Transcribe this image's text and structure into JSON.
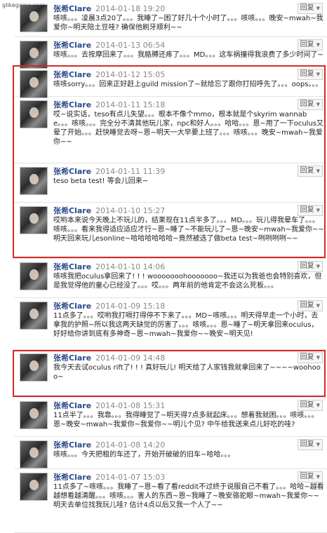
{
  "watermark": "glikegame.com",
  "reply_label": "回复",
  "posts": [
    {
      "author": "张希Clare",
      "time": "2014-01-18 19:20",
      "text": "咳咳。。。凌晨3点20了。。。我睡了~困了好几十个小时了。。。咳咳。。。晚安~mwah~我爱你~明天陪土豆哇? 确保他刷牙顺利~~"
    },
    {
      "author": "张希Clare",
      "time": "2014-01-13 06:54",
      "text": "咳咳。。。去按摩回来了。。。我胳膊还疼了。。。MD。。。这车祸撞得我浪费了多少时间了~"
    },
    {
      "author": "张希Clare",
      "time": "2014-01-12 15:05",
      "text": "咳咳sorry。。。回来正好赶上guild mission了~就给忘了跟你打招呼先了。。。oops。。。"
    },
    {
      "author": "张希Clare",
      "time": "2014-01-11 15:18",
      "text": "哎~说实话，teso有点儿失望。。。根本不像个mmo，根本就是个skyrim wannabe。。。咳咳。。。完全分不清其他玩儿家，npc和好人。。。哈哈。。。恩~用了一下oculus又晕了开始。。。赶快睡觉去呀~恩~明天一大早要上班了。。。咳咳。。。晚安~mwah~我爱你~~"
    },
    {
      "author": "张希Clare",
      "time": "2014-01-11 11:39",
      "text": "teso beta test! 等会儿回来~"
    },
    {
      "author": "张希Clare",
      "time": "2014-01-10 15:27",
      "text": "哎哟本来说今天晚上不玩儿的，结果现在11点半多了。。。MD。。。玩儿得我晕车了。。。咳咳。。。看来我得适应适应才行~恩~睡了~不能玩儿了~恩~晚安~mwah~我爱你~~明天回来玩儿esonline~哈哈哈哈哈哈~竟然被选了做beta test~咧咧咧咧~~"
    },
    {
      "author": "张希Clare",
      "time": "2014-01-10 14:06",
      "text": "咳咳我把oculus拿回来了! ! ! wooooooohooooooo~我还以为我爸也会特别喜欢，但是我觉得他的童心已经没了。。。哎。。。两年前的他肯定不会这么死板。。。"
    },
    {
      "author": "张希Clare",
      "time": "2014-01-09 15:18",
      "text": "11点多了。。。哎哟我打嗝打得停不下来了。。。MD~咳咳。。。明天得早走一个小时，去拿我的护照~所以我这两天缺觉的厉害了。。。咳咳。。。恩~睡了~明天拿回来oculus，好好给你讲到底有多神奇~恩~mwah~我爱你~~晚安~明天见!"
    },
    {
      "author": "张希Clare",
      "time": "2014-01-09 14:48",
      "text": "我今天去试oculus rift了! ! ! 真好玩儿! 明天给了人家钱我就拿回来了~~~~woohooo~"
    },
    {
      "author": "张希Clare",
      "time": "2014-01-08 15:31",
      "text": "11点半了。。。我靠。。。我得睡觉了~明天得7点多就起床。。。想着我就困。。。咳咳。。。恩~晚安~mwah~我爱你~我爱你~~明儿个见? 中午给我送来点儿好吃的哇?"
    },
    {
      "author": "张希Clare",
      "time": "2014-01-08 14:20",
      "text": "咳咳。。。今天把租的车还了，开始开破破的旧车~哈哈。。。"
    },
    {
      "author": "张希Clare",
      "time": "2014-01-07 15:03",
      "text": "11点多了~咳咳。。。我睡了~恩~看了看reddit不过终于说服自己不看了。。。哈哈~越看越想看越清醒。。。咳咳。。。害人的东西~恩~我睡了~晚安骆驼眼~mwah~我爱你~~明天去单位找我玩儿哇? 估计4点以后又我一个人了~~"
    }
  ]
}
